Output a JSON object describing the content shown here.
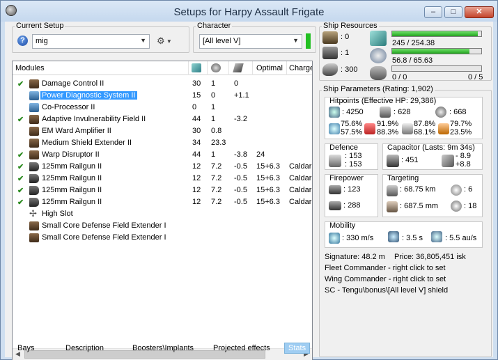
{
  "window": {
    "title": "Setups for Harpy Assault Frigate"
  },
  "current_setup": {
    "label": "Current Setup",
    "value": "mig"
  },
  "character": {
    "label": "Character",
    "value": "[All level V]",
    "status_color": "#22c022"
  },
  "modules": {
    "headers": [
      "Modules",
      "Optimal",
      "Charge"
    ],
    "rows": [
      {
        "checked": true,
        "name": "Damage Control II",
        "v1": "30",
        "v2": "1",
        "v3": "0",
        "v4": "",
        "v5": ""
      },
      {
        "checked": false,
        "name": "Power Diagnostic System II",
        "v1": "15",
        "v2": "0",
        "v3": "+1.1",
        "v4": "",
        "v5": ""
      },
      {
        "checked": false,
        "name": "Co-Processor II",
        "v1": "0",
        "v2": "1",
        "v3": "",
        "v4": "",
        "v5": ""
      },
      {
        "checked": true,
        "name": "Adaptive Invulnerability Field II",
        "v1": "44",
        "v2": "1",
        "v3": "-3.2",
        "v4": "",
        "v5": ""
      },
      {
        "checked": false,
        "name": "EM Ward Amplifier II",
        "v1": "30",
        "v2": "0.8",
        "v3": "",
        "v4": "",
        "v5": ""
      },
      {
        "checked": false,
        "name": "Medium Shield Extender II",
        "v1": "34",
        "v2": "23.3",
        "v3": "",
        "v4": "",
        "v5": ""
      },
      {
        "checked": true,
        "name": "Warp Disruptor II",
        "v1": "44",
        "v2": "1",
        "v3": "-3.8",
        "v4": "24",
        "v5": ""
      },
      {
        "checked": true,
        "name": "125mm Railgun II",
        "v1": "12",
        "v2": "7.2",
        "v3": "-0.5",
        "v4": "15+6.3",
        "v5": "Caldari"
      },
      {
        "checked": true,
        "name": "125mm Railgun II",
        "v1": "12",
        "v2": "7.2",
        "v3": "-0.5",
        "v4": "15+6.3",
        "v5": "Caldari"
      },
      {
        "checked": true,
        "name": "125mm Railgun II",
        "v1": "12",
        "v2": "7.2",
        "v3": "-0.5",
        "v4": "15+6.3",
        "v5": "Caldari"
      },
      {
        "checked": true,
        "name": "125mm Railgun II",
        "v1": "12",
        "v2": "7.2",
        "v3": "-0.5",
        "v4": "15+6.3",
        "v5": "Caldari"
      },
      {
        "checked": false,
        "name": "High Slot",
        "v1": "",
        "v2": "",
        "v3": "",
        "v4": "",
        "v5": ""
      },
      {
        "checked": false,
        "name": "Small Core Defense Field Extender I",
        "v1": "",
        "v2": "",
        "v3": "",
        "v4": "",
        "v5": ""
      },
      {
        "checked": false,
        "name": "Small Core Defense Field Extender I",
        "v1": "",
        "v2": "",
        "v3": "",
        "v4": "",
        "v5": ""
      }
    ]
  },
  "tabs": [
    "Bays",
    "Description",
    "Boosters\\Implants",
    "Projected effects",
    "Stats"
  ],
  "ship_resources": {
    "label": "Ship Resources",
    "turret": ": 0",
    "launcher": ": 1",
    "drone_bay": ": 300",
    "cpu": "245 / 254.38",
    "cpu_fraction": 0.963,
    "powergrid": "56.8 / 65.63",
    "powergrid_fraction": 0.865,
    "drone_bw": "0 / 0",
    "drone_count": "0 / 5"
  },
  "ship_parameters": {
    "label": "Ship Parameters (Rating: 1,902)",
    "hitpoints_label": "Hitpoints (Effective HP: 29,386)",
    "shield_hp": ": 4250",
    "armor_hp": ": 628",
    "structure_hp": ": 668",
    "res1a": "75.6%",
    "res1b": "57.5%",
    "res2a": "91.9%",
    "res2b": "88.3%",
    "res3a": "87.8%",
    "res3b": "68.1%",
    "res4a": "79.7%",
    "res4b": "23.5%",
    "defence_label": "Defence",
    "def_a": ": 153",
    "def_b": ": 153",
    "capacitor_label": "Capacitor (Lasts: 9m 34s)",
    "cap_amount": ": 451",
    "cap_minus": "- 8.9",
    "cap_plus": "+8.8",
    "firepower_label": "Firepower",
    "fp_turret": ": 123",
    "fp_missile": ": 288",
    "targeting_label": "Targeting",
    "range": ": 68.75 km",
    "targets": ": 6",
    "scan": ": 687.5 mm",
    "sensor": ": 18",
    "mobility_label": "Mobility",
    "speed": ": 330 m/s",
    "align": ": 3.5 s",
    "warp": ": 5.5 au/s"
  },
  "info": {
    "signature": "Signature: 48.2 m",
    "price": "Price: 36,805,451 isk",
    "fleet": "Fleet Commander - right click to set",
    "wing": "Wing Commander - right click to set",
    "sc": "SC - Tengu\\bonus\\[All level V] shield"
  }
}
